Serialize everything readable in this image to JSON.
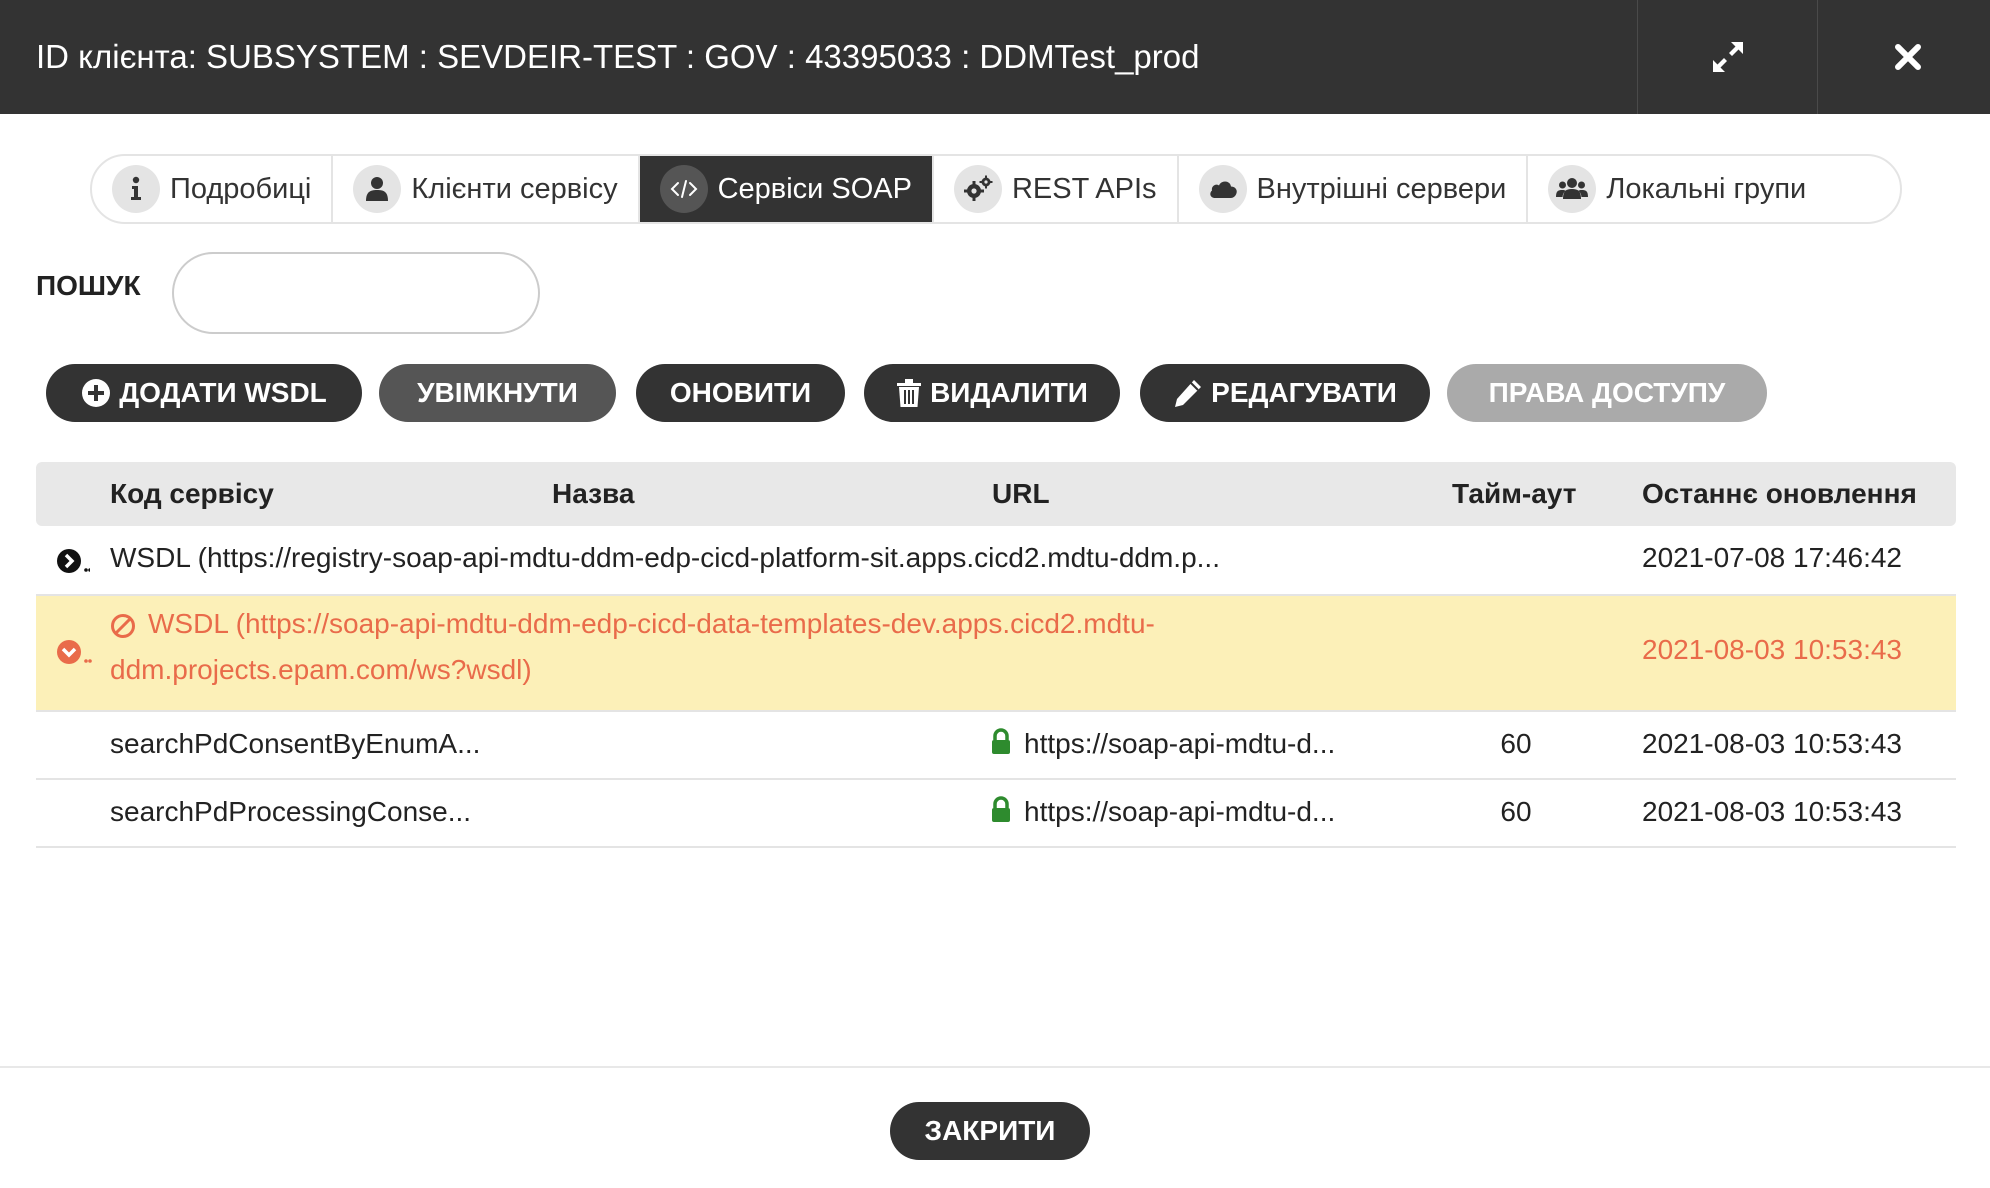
{
  "window": {
    "title": "ID клієнта: SUBSYSTEM : SEVDEIR-TEST : GOV : 43395033 : DDMTest_prod",
    "maximize_icon": "expand-icon",
    "close_icon": "close-icon"
  },
  "tabs": [
    {
      "label": "Подробиці",
      "icon": "info-icon",
      "active": false
    },
    {
      "label": "Клієнти сервісу",
      "icon": "user-icon",
      "active": false
    },
    {
      "label": "Сервіси SOAP",
      "icon": "code-icon",
      "active": true
    },
    {
      "label": "REST APIs",
      "icon": "gears-icon",
      "active": false
    },
    {
      "label": "Внутрішні сервери",
      "icon": "cloud-icon",
      "active": false
    },
    {
      "label": "Локальні групи",
      "icon": "users-icon",
      "active": false
    }
  ],
  "search": {
    "label": "ПОШУК",
    "value": ""
  },
  "actions": {
    "add_wsdl": "ДОДАТИ WSDL",
    "enable": "УВІМКНУТИ",
    "refresh": "ОНОВИТИ",
    "delete": "ВИДАЛИТИ",
    "edit": "РЕДАГУВАТИ",
    "access_rights": "ПРАВА ДОСТУПУ"
  },
  "table": {
    "columns": [
      "Код сервісу",
      "Назва",
      "URL",
      "Тайм-аут",
      "Останнє оновлення"
    ],
    "rows": [
      {
        "type": "wsdl",
        "state": "collapsed",
        "label": "WSDL (https://registry-soap-api-mdtu-ddm-edp-cicd-platform-sit.apps.cicd2.mdtu-ddm.p...",
        "updated": "2021-07-08 17:46:42"
      },
      {
        "type": "wsdl",
        "state": "expanded-disabled",
        "label_line1": "WSDL (https://soap-api-mdtu-ddm-edp-cicd-data-templates-dev.apps.cicd2.mdtu-",
        "label_line2": "ddm.projects.epam.com/ws?wsdl)",
        "updated": "2021-08-03 10:53:43",
        "status_color": "#e96b4a"
      },
      {
        "type": "service",
        "code": "searchPdConsentByEnumA...",
        "name": "",
        "url": "https://soap-api-mdtu-d...",
        "timeout": "60",
        "updated": "2021-08-03 10:53:43"
      },
      {
        "type": "service",
        "code": "searchPdProcessingConse...",
        "name": "",
        "url": "https://soap-api-mdtu-d...",
        "timeout": "60",
        "updated": "2021-08-03 10:53:43"
      }
    ]
  },
  "footer": {
    "close": "ЗАКРИТИ"
  },
  "colors": {
    "titlebar": "#333333",
    "warning_row": "#fcf0b8",
    "warning_text": "#e96b4a",
    "lock": "#2e8b2e",
    "disabled_button": "#aaaaaa"
  }
}
